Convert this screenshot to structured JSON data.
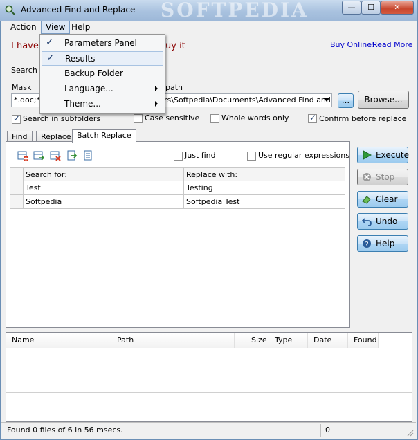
{
  "window": {
    "title": "Advanced Find and Replace",
    "watermark": "SOFTPEDIA"
  },
  "title_buttons": {
    "minimize": "—",
    "maximize": "☐",
    "close": "✕"
  },
  "menubar": {
    "items": [
      "Action",
      "View",
      "Help"
    ]
  },
  "view_menu": {
    "items": [
      {
        "label": "Parameters Panel",
        "checked": true,
        "submenu": false
      },
      {
        "label": "Results",
        "checked": true,
        "submenu": false
      },
      {
        "label": "Backup Folder",
        "checked": false,
        "submenu": false
      },
      {
        "label": "Language...",
        "checked": false,
        "submenu": true
      },
      {
        "label": "Theme...",
        "checked": false,
        "submenu": true
      }
    ]
  },
  "promo": {
    "text_left": "I have j",
    "text_right": "uy it",
    "buy_online": "Buy Online!",
    "read_more": "Read More"
  },
  "search_in_label": "Search i",
  "mask": {
    "label": "Mask",
    "value": "*.doc;*.",
    "path_label": "path",
    "path_value": "rs\\Softpedia\\Documents\\Advanced Find and F",
    "ellipsis": "...",
    "browse": "Browse..."
  },
  "options": {
    "search_subfolders": {
      "label": "Search in subfolders",
      "checked": true
    },
    "case_sensitive": {
      "label": "Case sensitive",
      "checked": false
    },
    "whole_words": {
      "label": "Whole words only",
      "checked": false
    },
    "confirm_replace": {
      "label": "Confirm before replace",
      "checked": true
    }
  },
  "tabs": [
    "Find",
    "Replace",
    "Batch Replace"
  ],
  "batch": {
    "just_find": "Just find",
    "use_regex": "Use regular expressions",
    "columns": [
      "Search for:",
      "Replace with:"
    ],
    "rows": [
      [
        "Test",
        "Testing"
      ],
      [
        "Softpedia",
        "Softpedia Test"
      ]
    ]
  },
  "side_buttons": [
    "Execute",
    "Stop",
    "Clear",
    "Undo",
    "Help"
  ],
  "results": {
    "columns": [
      "Name",
      "Path",
      "Size",
      "Type",
      "Date",
      "Found"
    ]
  },
  "status": {
    "message": "Found 0 files of 6 in 56 msecs.",
    "count": "0"
  },
  "colors": {
    "accent": "#3c7fb1",
    "link": "#0000cc",
    "promo_text": "#8b0000"
  }
}
